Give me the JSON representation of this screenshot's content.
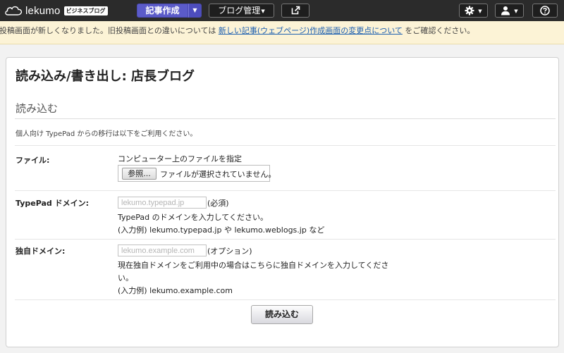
{
  "header": {
    "brand": "lekumo",
    "brand_badge": "ビジネスブログ",
    "compose_label": "記事作成",
    "blog_menu_label": "ブログ管理",
    "icons": [
      "cloud-logo-icon",
      "external-link-icon",
      "gear-icon",
      "user-icon",
      "help-icon"
    ]
  },
  "notice": {
    "text_before": "投稿画面が新しくなりました。旧投稿画面との違いについては",
    "link_text": "新しい記事(ウェブページ)作成画面の変更点について",
    "text_after": "をご確認ください。"
  },
  "page": {
    "title": "読み込み/書き出し: 店長ブログ",
    "section_title": "読み込む",
    "intro": "個人向け TypePad からの移行は以下をご利用ください。"
  },
  "form": {
    "file": {
      "label": "ファイル:",
      "hint": "コンピューター上のファイルを指定",
      "browse_label": "参照...",
      "status": "ファイルが選択されていません。"
    },
    "typepad": {
      "label": "TypePad ドメイン:",
      "placeholder": "lekumo.typepad.jp",
      "suffix": "(必須)",
      "desc": "TypePad のドメインを入力してください。",
      "example": "(入力例) lekumo.typepad.jp や lekumo.weblogs.jp など"
    },
    "custom": {
      "label": "独自ドメイン:",
      "placeholder": "lekumo.example.com",
      "suffix": "(オプション)",
      "desc_line1": "現在独自ドメインをご利用中の場合はこちらに独自ドメインを入力してくださ",
      "desc_line2": "い。",
      "example": "(入力例) lekumo.example.com"
    },
    "submit_label": "読み込む"
  },
  "colors": {
    "topbar": "#2b2b2b",
    "compose_button": "#5b5bc9",
    "notice_bg": "#fcf3d6",
    "link": "#1b5eb0"
  }
}
